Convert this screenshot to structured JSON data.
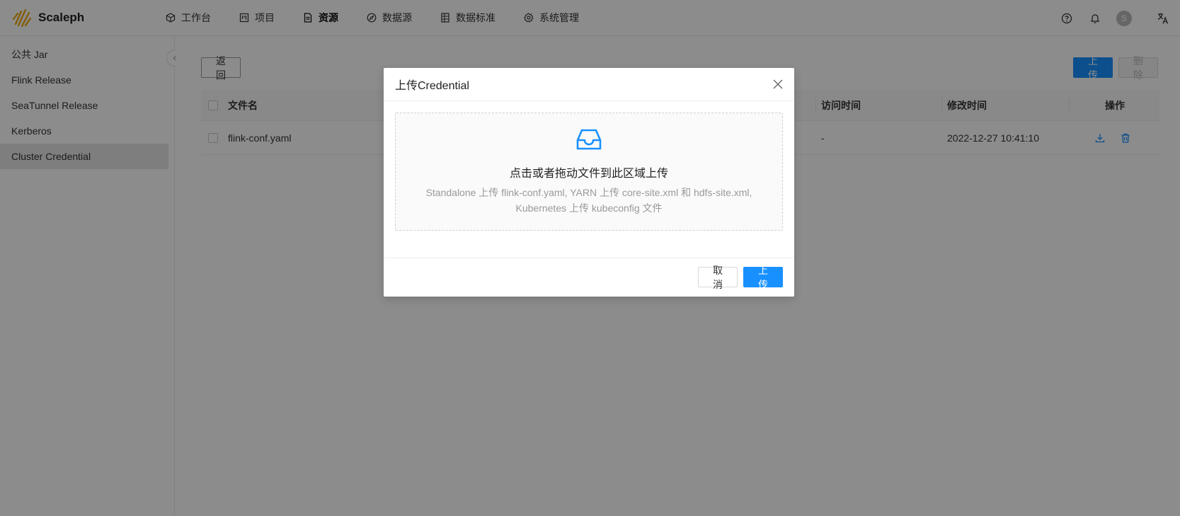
{
  "header": {
    "brand": "Scaleph",
    "nav": [
      {
        "label": "工作台",
        "icon": "cube-icon"
      },
      {
        "label": "项目",
        "icon": "project-icon"
      },
      {
        "label": "资源",
        "icon": "file-icon",
        "active": true
      },
      {
        "label": "数据源",
        "icon": "compass-icon"
      },
      {
        "label": "数据标准",
        "icon": "table-icon"
      },
      {
        "label": "系统管理",
        "icon": "gear-icon"
      }
    ],
    "avatar_initial": "S"
  },
  "sidebar": {
    "items": [
      {
        "label": "公共 Jar"
      },
      {
        "label": "Flink Release"
      },
      {
        "label": "SeaTunnel Release"
      },
      {
        "label": "Kerberos"
      },
      {
        "label": "Cluster Credential",
        "active": true
      }
    ]
  },
  "toolbar": {
    "back_label": "返 回",
    "upload_label": "上 传",
    "delete_label": "删 除"
  },
  "table": {
    "columns": {
      "file_name": "文件名",
      "access_time": "访问时间",
      "modify_time": "修改时间",
      "actions": "操作"
    },
    "rows": [
      {
        "file_name": "flink-conf.yaml",
        "access_time": "-",
        "modify_time": "2022-12-27 10:41:10"
      }
    ]
  },
  "modal": {
    "title": "上传Credential",
    "drop_title": "点击或者拖动文件到此区域上传",
    "drop_hint": "Standalone 上传 flink-conf.yaml, YARN 上传 core-site.xml 和 hdfs-site.xml, Kubernetes 上传 kubeconfig 文件",
    "cancel_label": "取 消",
    "confirm_label": "上 传"
  },
  "colors": {
    "primary": "#1890ff",
    "logo": "#f0a500"
  }
}
